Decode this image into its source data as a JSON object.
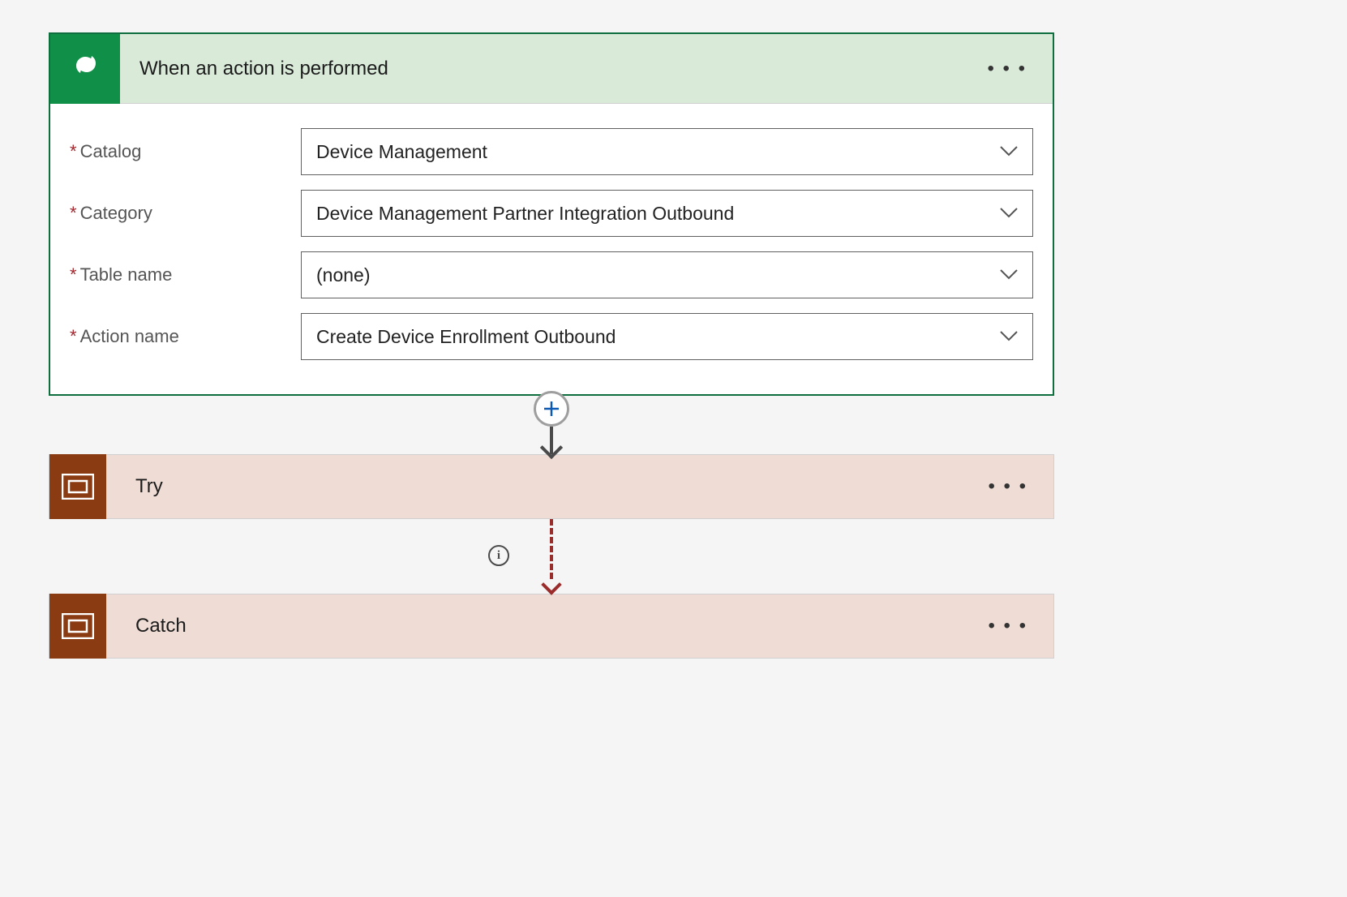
{
  "trigger": {
    "title": "When an action is performed",
    "fields": {
      "catalog": {
        "label": "Catalog",
        "value": "Device Management"
      },
      "category": {
        "label": "Category",
        "value": "Device Management Partner Integration Outbound"
      },
      "tableName": {
        "label": "Table name",
        "value": "(none)"
      },
      "actionName": {
        "label": "Action name",
        "value": "Create Device Enrollment Outbound"
      }
    }
  },
  "scopes": {
    "try": {
      "title": "Try"
    },
    "catch": {
      "title": "Catch"
    }
  },
  "glyphs": {
    "more": "• • •",
    "info": "i"
  },
  "colors": {
    "triggerAccent": "#0f8f47",
    "triggerHeaderBg": "#d9ead9",
    "scopeAccent": "#8a3b12",
    "scopeBg": "#efdcd4",
    "dashedArrow": "#9b2c2c"
  }
}
